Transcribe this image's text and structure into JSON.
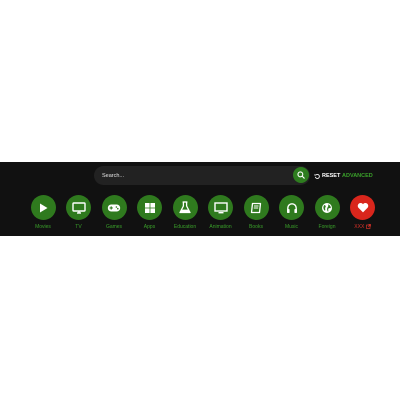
{
  "search": {
    "placeholder": "Search..."
  },
  "actions": {
    "reset_label": "RESET",
    "advanced_label": "ADVANCED"
  },
  "categories": [
    {
      "label": "Movies",
      "icon": "play-icon"
    },
    {
      "label": "TV",
      "icon": "monitor-icon"
    },
    {
      "label": "Games",
      "icon": "gamepad-icon"
    },
    {
      "label": "Apps",
      "icon": "windows-icon"
    },
    {
      "label": "Education",
      "icon": "flask-icon"
    },
    {
      "label": "Animation",
      "icon": "display-icon"
    },
    {
      "label": "Books",
      "icon": "book-icon"
    },
    {
      "label": "Music",
      "icon": "headphones-icon"
    },
    {
      "label": "Foreign",
      "icon": "globe-icon"
    },
    {
      "label": "XXX",
      "icon": "heart-icon"
    }
  ],
  "colors": {
    "band": "#111111",
    "accent_green": "#2f7a1e",
    "label_green": "#3aa12a",
    "adult_red": "#d9261c"
  }
}
